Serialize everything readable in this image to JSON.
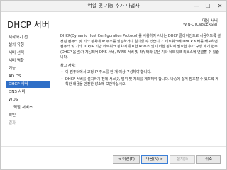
{
  "window": {
    "title": "역할 및 기능 추가 마법사",
    "controls": {
      "minimize": "—",
      "maximize": "☐",
      "close": "✕"
    }
  },
  "header": {
    "page_title": "DHCP 서버",
    "destination_label": "대상 서버",
    "destination_server": "WIN-OTCV8ZERSNT"
  },
  "nav": {
    "items": [
      {
        "label": "시작하기 전",
        "state": "normal",
        "indent": false
      },
      {
        "label": "설치 유형",
        "state": "normal",
        "indent": false
      },
      {
        "label": "서버 선택",
        "state": "normal",
        "indent": false
      },
      {
        "label": "서버 역할",
        "state": "normal",
        "indent": false
      },
      {
        "label": "기능",
        "state": "normal",
        "indent": false
      },
      {
        "label": "AD DS",
        "state": "normal",
        "indent": false
      },
      {
        "label": "DHCP 서버",
        "state": "active",
        "indent": false
      },
      {
        "label": "DNS 서버",
        "state": "normal",
        "indent": false
      },
      {
        "label": "WDS",
        "state": "normal",
        "indent": false
      },
      {
        "label": "역할 서비스",
        "state": "normal",
        "indent": true
      },
      {
        "label": "확인",
        "state": "normal",
        "indent": false
      },
      {
        "label": "결과",
        "state": "disabled",
        "indent": false
      }
    ]
  },
  "content": {
    "paragraph": "DHCP(Dynamic Host Configuration Protocol)를 사용하여 서버는 DHCP 클라이언트로 사용하도록 설정된 컴퓨터 및 기타 장치에 IP 주소를 할당하거나 임대할 수 있습니다. 네트워크에 DHCP 서버를 배포하면 컴퓨터 및 기타 TCP/IP 기반 네트워크 장치에 유효한 IP 주소 및 이러한 장치에 필요한 추가 구성 매개 변수(DHCP 옵션)가 제공되어 DNS 서버, WINS 서버 및 라우터와 같은 기타 네트워크 리소스에 연결할 수 있습니다.",
    "notice_title": "참고 사항:",
    "bullets": [
      "이 컴퓨터에서 고정 IP 주소를 한 개 이상 구성해야 합니다.",
      "DHCP 서버를 설치하기 전에 서브넷, 범위 및 제외를 계획해야 합니다. 나중에 쉽게 참조할 수 있도록 계획한 내용을 안전한 장소에 보관하십시오."
    ]
  },
  "footer": {
    "prev_label": "< 이전(P)",
    "next_label": "다음(N) >",
    "install_label": "설치(I)",
    "cancel_label": "취소"
  },
  "colors": {
    "active_nav_bg": "#2f6fc7",
    "active_nav_text": "#ffffff",
    "disabled_text": "#9a9a9a"
  }
}
